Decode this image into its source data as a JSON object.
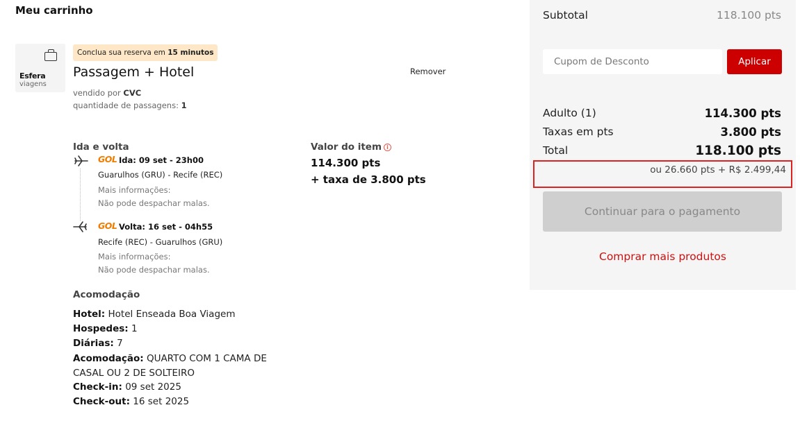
{
  "page": {
    "title": "Meu carrinho"
  },
  "product": {
    "brand": "Esfera",
    "brand_sub": "viagens",
    "timer_prefix": "Conclua sua reserva em ",
    "timer_value": "15 minutos",
    "title": "Passagem + Hotel",
    "remove_label": "Remover",
    "seller_prefix": "vendido por ",
    "seller_name": "CVC",
    "qty_prefix": "quantidade de passagens: ",
    "qty_value": "1"
  },
  "flights": {
    "heading": "Ida e volta",
    "airline_logo": "GOL",
    "outbound": {
      "header": "Ida: 09 set - 23h00",
      "route": "Guarulhos (GRU) - Recife (REC)",
      "info": "Mais informações:",
      "baggage": "Não pode despachar malas."
    },
    "inbound": {
      "header": "Volta: 16 set - 04h55",
      "route": "Recife (REC) - Guarulhos (GRU)",
      "info": "Mais informações:",
      "baggage": "Não pode despachar malas."
    }
  },
  "item_value": {
    "label": "Valor do item",
    "info_glyph": "i",
    "points": "114.300 pts",
    "tax": "+ taxa de 3.800 pts"
  },
  "accommodation": {
    "heading": "Acomodação",
    "hotel_label": "Hotel:",
    "hotel_value": "Hotel Enseada Boa Viagem",
    "guests_label": "Hospedes:",
    "guests_value": "1",
    "nights_label": "Diárias:",
    "nights_value": "7",
    "room_label": "Acomodação:",
    "room_value_line1": "QUARTO COM 1 CAMA DE",
    "room_value_line2": "CASAL OU 2 DE SOLTEIRO",
    "checkin_label": "Check-in:",
    "checkin_value": "09 set 2025",
    "checkout_label": "Check-out:",
    "checkout_value": "16 set 2025"
  },
  "summary": {
    "subtotal_label": "Subtotal",
    "subtotal_value": "118.100 pts",
    "coupon_placeholder": "Cupom de Desconto",
    "apply_label": "Aplicar",
    "adult_label": "Adulto (1)",
    "adult_value": "114.300 pts",
    "tax_label": "Taxas em pts",
    "tax_value": "3.800 pts",
    "total_label": "Total",
    "total_value": "118.100 pts",
    "alt_price": "ou 26.660 pts + R$ 2.499,44",
    "continue_label": "Continuar para o pagamento",
    "more_products_label": "Comprar mais produtos"
  },
  "colors": {
    "accent_red": "#cc0000",
    "timer_badge_bg": "#fde7c7",
    "gol_orange": "#ef7d00",
    "highlight_border": "#dd2222"
  }
}
